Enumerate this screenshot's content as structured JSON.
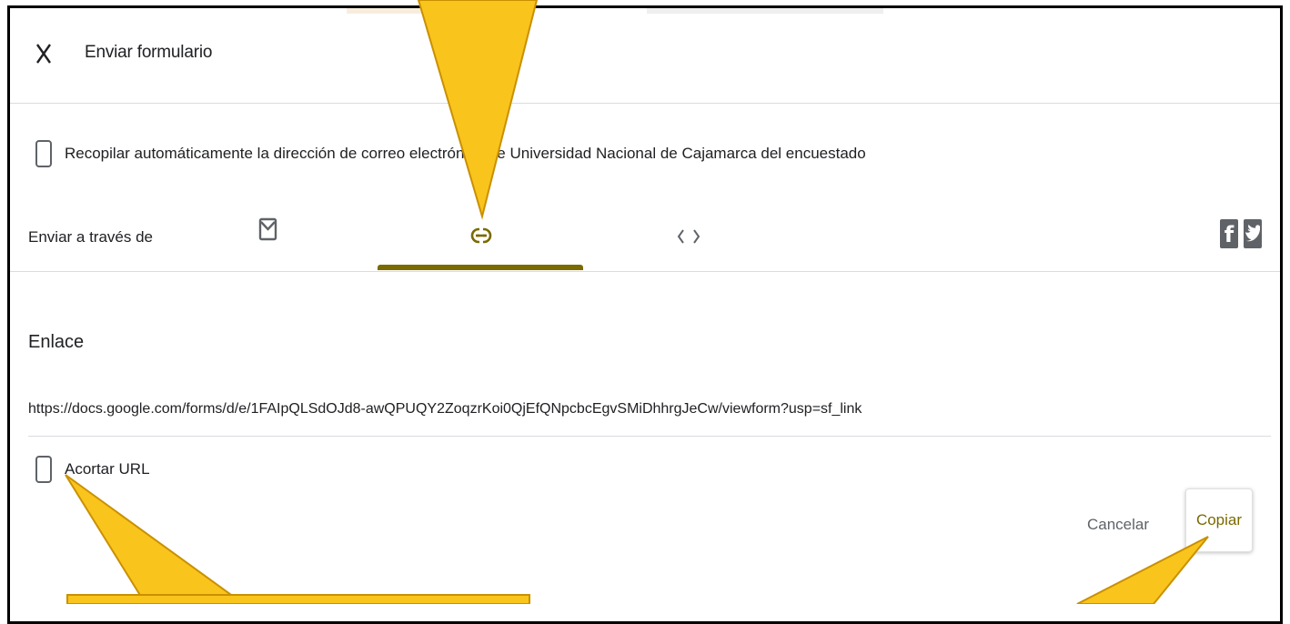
{
  "dialog": {
    "title": "Enviar formulario",
    "collect_email_label": "Recopilar automáticamente la dirección de correo electrónico de Universidad Nacional de Cajamarca del encuestado",
    "collect_email_checked": false,
    "send_via_label": "Enviar a través de",
    "tabs": [
      {
        "name": "email",
        "icon": "mail-icon"
      },
      {
        "name": "link",
        "icon": "link-icon",
        "selected": true
      },
      {
        "name": "embed",
        "icon": "embed-code-icon"
      }
    ],
    "social": [
      "facebook-icon",
      "twitter-icon"
    ],
    "link_section": {
      "heading": "Enlace",
      "url": "https://docs.google.com/forms/d/e/1FAIpQLSdOJd8-awQPUQY2ZoqzrKoi0QjEfQNpcbcEgvSMiDhhrgJeCw/viewform?usp=sf_link",
      "shorten_label": "Acortar URL",
      "shorten_checked": false
    },
    "buttons": {
      "cancel": "Cancelar",
      "copy": "Copiar"
    }
  },
  "colors": {
    "accent": "#7a6a00",
    "callout": "#f9c41c",
    "callout_edge": "#c99000",
    "icon_gray": "#5f6368",
    "divider": "#dadce0"
  }
}
